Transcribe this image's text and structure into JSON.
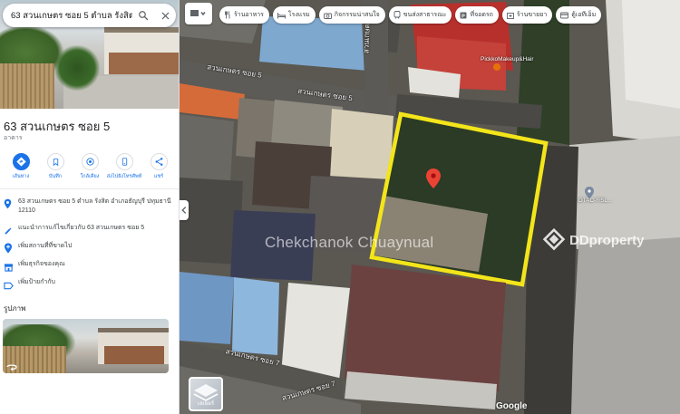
{
  "search": {
    "query": "63 สวนเกษตร ซอย 5 ตำบล รังสิต อำเภอธัญ"
  },
  "place": {
    "title": "63 สวนเกษตร ซอย 5",
    "subtitle": "อาคาร",
    "actions": [
      {
        "label": "เส้นทาง",
        "icon": "directions-icon"
      },
      {
        "label": "บันทึก",
        "icon": "bookmark-icon"
      },
      {
        "label": "ใกล้เคียง",
        "icon": "nearby-icon"
      },
      {
        "label": "ส่งไปยังโทรศัพท์",
        "icon": "send-to-phone-icon"
      },
      {
        "label": "แชร์",
        "icon": "share-icon"
      }
    ],
    "info_rows": [
      {
        "icon": "location-pin-icon",
        "text": "63 สวนเกษตร ซอย 5 ตำบล รังสิต อำเภอธัญบุรี ปทุมธานี 12110"
      },
      {
        "icon": "edit-pencil-icon",
        "text": "แนะนำการแก้ไขเกี่ยวกับ 63 สวนเกษตร ซอย 5"
      },
      {
        "icon": "add-place-icon",
        "text": "เพิ่มสถานที่ที่ขาดไป"
      },
      {
        "icon": "business-icon",
        "text": "เพิ่มธุรกิจของคุณ"
      },
      {
        "icon": "label-icon",
        "text": "เพิ่มป้ายกำกับ"
      }
    ],
    "photos_label": "รูปภาพ"
  },
  "map": {
    "chips": [
      {
        "label": "ร้านอาหาร",
        "icon": "restaurant-icon"
      },
      {
        "label": "โรงแรม",
        "icon": "hotel-icon"
      },
      {
        "label": "กิจกรรมน่าสนใจ",
        "icon": "camera-icon"
      },
      {
        "label": "ขนส่งสาธารณะ",
        "icon": "transit-icon"
      },
      {
        "label": "ที่จอดรถ",
        "icon": "parking-icon"
      },
      {
        "label": "ร้านขายยา",
        "icon": "pharmacy-icon"
      },
      {
        "label": "ตู้เอทีเอ็ม",
        "icon": "atm-icon"
      }
    ],
    "road_labels": [
      "สวนเกษตร ซอย 5",
      "สวนเกษตร ซอย 5",
      "สวนเกษตร ซอย 7",
      "สวนเกษตร ซอย 7",
      "สวนเกษตร"
    ],
    "place_labels": [
      "PickkoMakeup&Hair",
      "DTAC-RSL..."
    ],
    "layers_label": "เลเยอร์",
    "google_label": "Google",
    "watermark_name": "Chekchanok Chuaynual",
    "watermark_brand": "DDproperty",
    "colors": {
      "highlight": "#f3e51a",
      "pin": "#ea4335",
      "accent": "#1a73e8"
    }
  }
}
